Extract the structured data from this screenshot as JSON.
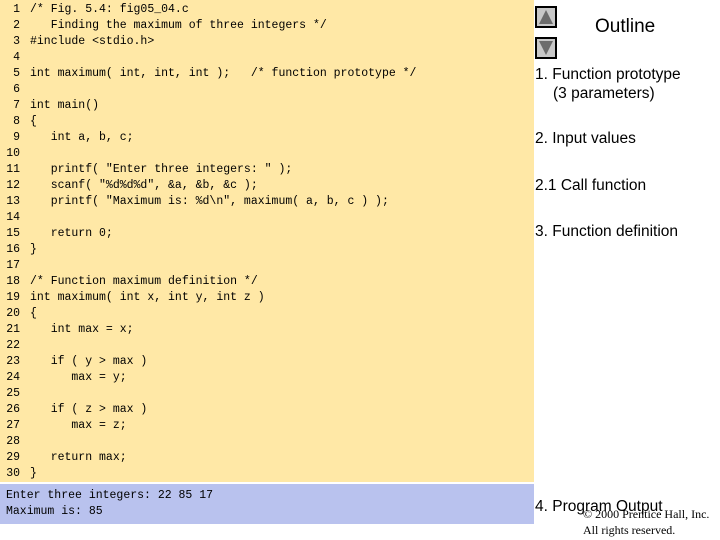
{
  "code_lines": [
    {
      "n": "1",
      "text": "/* Fig. 5.4: fig05_04.c"
    },
    {
      "n": "2",
      "text": "   Finding the maximum of three integers */"
    },
    {
      "n": "3",
      "text": "#include <stdio.h>"
    },
    {
      "n": "4",
      "text": ""
    },
    {
      "n": "5",
      "text": "int maximum( int, int, int );   /* function prototype */"
    },
    {
      "n": "6",
      "text": ""
    },
    {
      "n": "7",
      "text": "int main()"
    },
    {
      "n": "8",
      "text": "{"
    },
    {
      "n": "9",
      "text": "   int a, b, c;"
    },
    {
      "n": "10",
      "text": ""
    },
    {
      "n": "11",
      "text": "   printf( \"Enter three integers: \" );"
    },
    {
      "n": "12",
      "text": "   scanf( \"%d%d%d\", &a, &b, &c );"
    },
    {
      "n": "13",
      "text": "   printf( \"Maximum is: %d\\n\", maximum( a, b, c ) );"
    },
    {
      "n": "14",
      "text": ""
    },
    {
      "n": "15",
      "text": "   return 0;"
    },
    {
      "n": "16",
      "text": "}"
    },
    {
      "n": "17",
      "text": ""
    },
    {
      "n": "18",
      "text": "/* Function maximum definition */"
    },
    {
      "n": "19",
      "text": "int maximum( int x, int y, int z )"
    },
    {
      "n": "20",
      "text": "{"
    },
    {
      "n": "21",
      "text": "   int max = x;"
    },
    {
      "n": "22",
      "text": ""
    },
    {
      "n": "23",
      "text": "   if ( y > max )"
    },
    {
      "n": "24",
      "text": "      max = y;"
    },
    {
      "n": "25",
      "text": ""
    },
    {
      "n": "26",
      "text": "   if ( z > max )"
    },
    {
      "n": "27",
      "text": "      max = z;"
    },
    {
      "n": "28",
      "text": ""
    },
    {
      "n": "29",
      "text": "   return max;"
    },
    {
      "n": "30",
      "text": "}"
    }
  ],
  "program_output": [
    "Enter three integers: 22 85 17",
    "Maximum is: 85"
  ],
  "outline": {
    "title": "Outline",
    "items": [
      {
        "line1": "1.  Function prototype",
        "line2": "(3 parameters)"
      },
      {
        "line1": "2.  Input values",
        "line2": ""
      },
      {
        "line1": "2.1  Call function",
        "line2": ""
      },
      {
        "line1": "3. Function definition",
        "line2": ""
      },
      {
        "line1": "4. Program Output",
        "line2": ""
      }
    ]
  },
  "nav": {
    "up_icon": "triangle-up-icon",
    "down_icon": "triangle-down-icon"
  },
  "copyright": {
    "line1": "© 2000 Prentice Hall, Inc.",
    "line2": "All rights reserved."
  },
  "colors": {
    "code_bg": "#ffe8a6",
    "output_bg": "#b9c2ee",
    "nav_button": "#c8c8c8"
  }
}
